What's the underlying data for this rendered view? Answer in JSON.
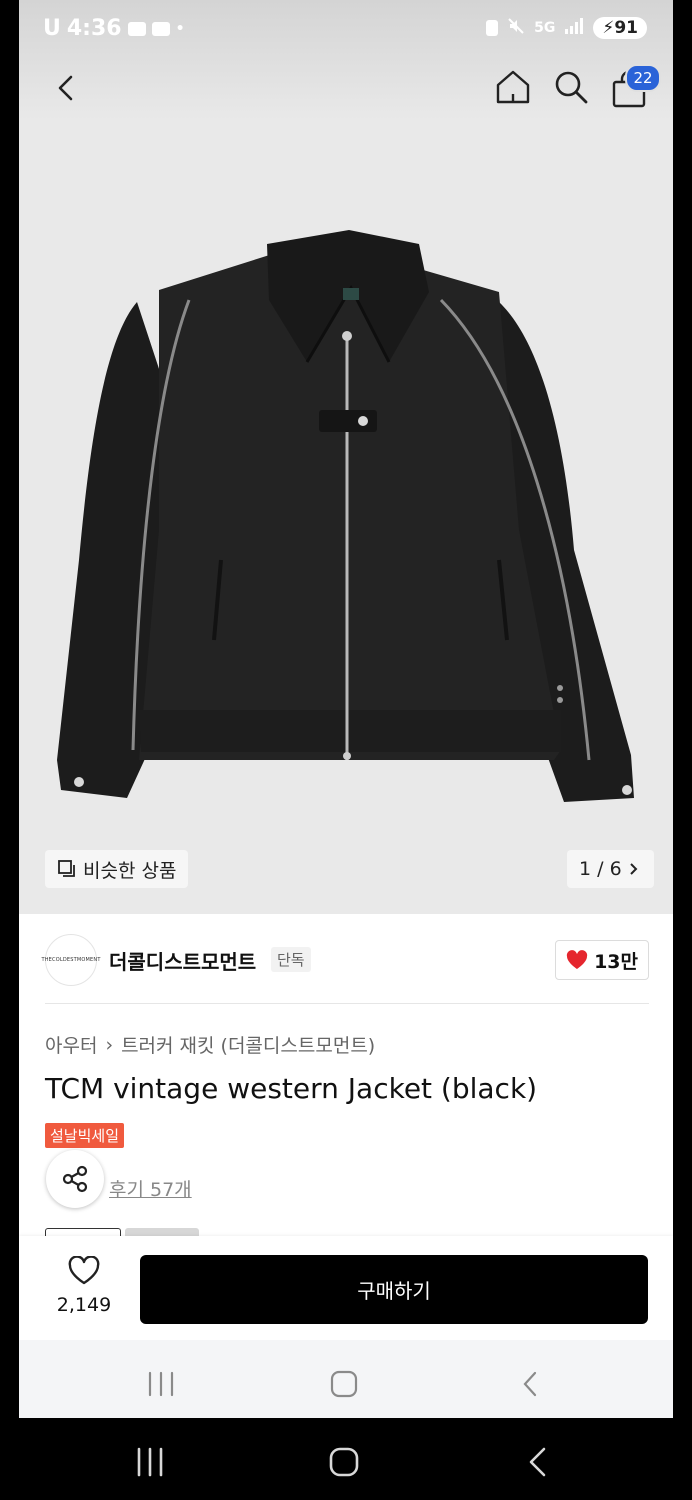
{
  "status": {
    "time": "4:36",
    "carrier": "U",
    "network": "5G",
    "battery": "91"
  },
  "nav": {
    "cart_count": "22"
  },
  "gallery": {
    "similar_label": "비슷한 상품",
    "page": "1 / 6"
  },
  "brand": {
    "logo_text": "THECOLDESTMOMENT",
    "name": "더콜디스트모먼트",
    "tag": "단독",
    "likes": "13만"
  },
  "breadcrumb": {
    "category": "아우터",
    "subcategory": "트러커 재킷 (더콜디스트모먼트)"
  },
  "product": {
    "title": "TCM vintage western Jacket (black)",
    "sale_badge": "설날빅세일",
    "reviews": "후기 57개"
  },
  "bottom": {
    "wish_count": "2,149",
    "buy_label": "구매하기"
  },
  "colors": {
    "accent": "#2a63d8",
    "sale": "#f05a3e",
    "heart": "#e5262e",
    "buy": "#000000"
  }
}
